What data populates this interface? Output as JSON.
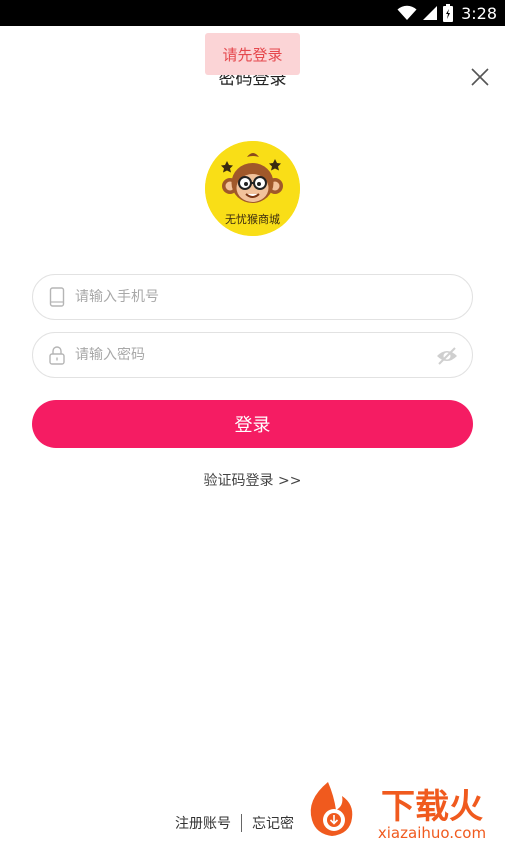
{
  "status_bar": {
    "time": "3:28"
  },
  "header": {
    "title": "密码登录"
  },
  "toast": {
    "text": "请先登录"
  },
  "logo": {
    "text": "无忧猴商城"
  },
  "form": {
    "phone_placeholder": "请输入手机号",
    "password_placeholder": "请输入密码",
    "login_label": "登录"
  },
  "sms_login": {
    "label": "验证码登录 >>"
  },
  "footer": {
    "register_label": "注册账号",
    "forgot_label": "忘记密"
  },
  "watermark": {
    "brand": "下载火",
    "site": "xiazaihuo.com"
  },
  "colors": {
    "accent": "#f51c63",
    "toast_bg": "#fbd4d6",
    "toast_text": "#e5484d",
    "logo_bg": "#f9de17",
    "watermark": "#f05a1e"
  }
}
